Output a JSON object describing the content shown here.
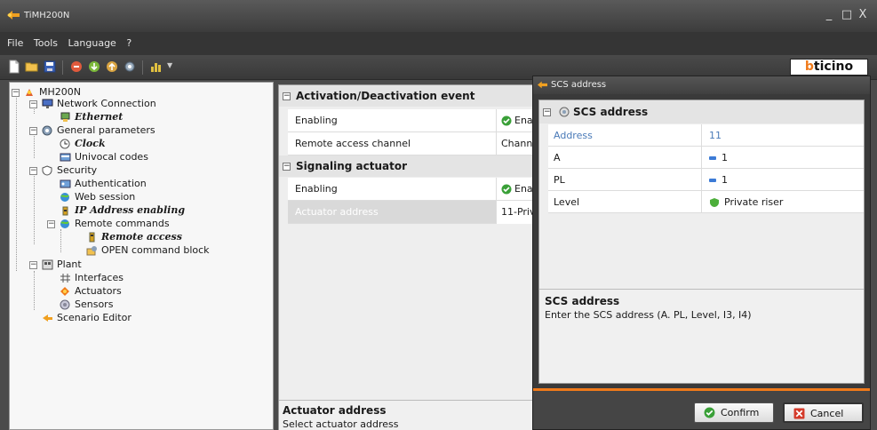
{
  "window": {
    "title": "TiMH200N"
  },
  "menu": [
    "File",
    "Tools",
    "Language",
    "?"
  ],
  "brand": {
    "logo_pre": "b",
    "logo_rest": "ticino",
    "accent": "#f07a1a"
  },
  "tree": {
    "root": "MH200N",
    "network_connection": "Network Connection",
    "ethernet": "Ethernet",
    "general_parameters": "General parameters",
    "clock": "Clock",
    "univocal_codes": "Univocal codes",
    "security": "Security",
    "authentication": "Authentication",
    "web_session": "Web session",
    "ip_address_enabling": "IP Address enabling",
    "remote_commands": "Remote commands",
    "remote_access": "Remote access",
    "open_command_block": "OPEN command block",
    "plant": "Plant",
    "interfaces": "Interfaces",
    "actuators": "Actuators",
    "sensors": "Sensors",
    "scenario_editor": "Scenario Editor"
  },
  "props": {
    "group1": "Activation/Deactivation event",
    "enabling_label": "Enabling",
    "enabling_value": "Enab",
    "remote_channel_label": "Remote access channel",
    "remote_channel_value": "Channel",
    "group2": "Signaling actuator",
    "enabling2_label": "Enabling",
    "enabling2_value": "Enab",
    "actuator_label": "Actuator address",
    "actuator_value": "11-Priva",
    "desc_title": "Actuator address",
    "desc_text": "Select actuator address"
  },
  "dialog": {
    "title": "SCS address",
    "group": "SCS address",
    "rows": [
      {
        "key": "Address",
        "value": "11"
      },
      {
        "key": "A",
        "value": "1"
      },
      {
        "key": "PL",
        "value": "1"
      },
      {
        "key": "Level",
        "value": "Private riser"
      }
    ],
    "desc_title": "SCS address",
    "desc_text": "Enter the SCS address (A. PL, Level, I3, I4)",
    "confirm": "Confirm",
    "cancel": "Cancel"
  }
}
